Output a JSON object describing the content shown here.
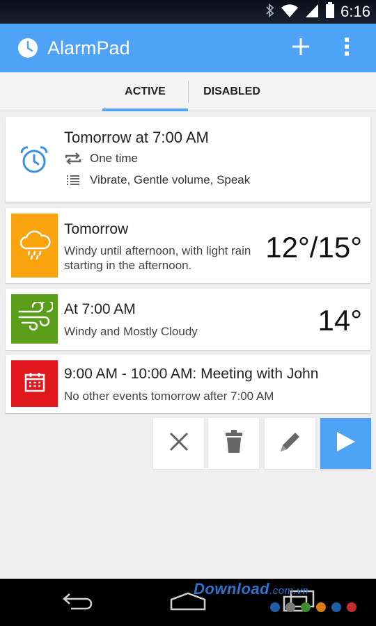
{
  "status_bar": {
    "time": "6:16",
    "icons": [
      "bluetooth-icon",
      "wifi-icon",
      "signal-icon",
      "battery-icon"
    ]
  },
  "app_bar": {
    "title": "AlarmPad",
    "actions": [
      "add-icon",
      "more-vert-icon"
    ]
  },
  "tabs": [
    {
      "label": "ACTIVE",
      "selected": true
    },
    {
      "label": "DISABLED",
      "selected": false
    }
  ],
  "alarm": {
    "title": "Tomorrow at 7:00 AM",
    "repeat": "One time",
    "options": "Vibrate, Gentle volume, Speak"
  },
  "weather_forecast": {
    "title": "Tomorrow",
    "description": "Windy until afternoon, with light rain starting in the afternoon.",
    "temperature": "12°/15°",
    "icon": "rain-cloud-icon"
  },
  "hourly_forecast": {
    "title": "At 7:00 AM",
    "description": "Windy and Mostly Cloudy",
    "temperature": "14°",
    "icon": "wind-icon"
  },
  "calendar_event": {
    "title": "9:00 AM - 10:00 AM: Meeting with John",
    "description": "No other events tomorrow after 7:00 AM",
    "icon": "calendar-icon"
  },
  "actions": [
    "close-icon",
    "trash-icon",
    "pencil-icon",
    "play-icon"
  ],
  "navigation": [
    "back-icon",
    "home-icon",
    "recent-apps-icon"
  ],
  "watermark": {
    "brand": "Download",
    "domain": ".com.vn",
    "dot_colors": [
      "#1e5fa8",
      "#7a7a7a",
      "#3d8c2f",
      "#d97e12",
      "#1e5fa8",
      "#c62a2a"
    ]
  },
  "colors": {
    "accent": "#4fa3f7",
    "weather_tile": "#f9a30f",
    "hour_tile": "#5a9e1a",
    "event_tile": "#e2171d"
  }
}
